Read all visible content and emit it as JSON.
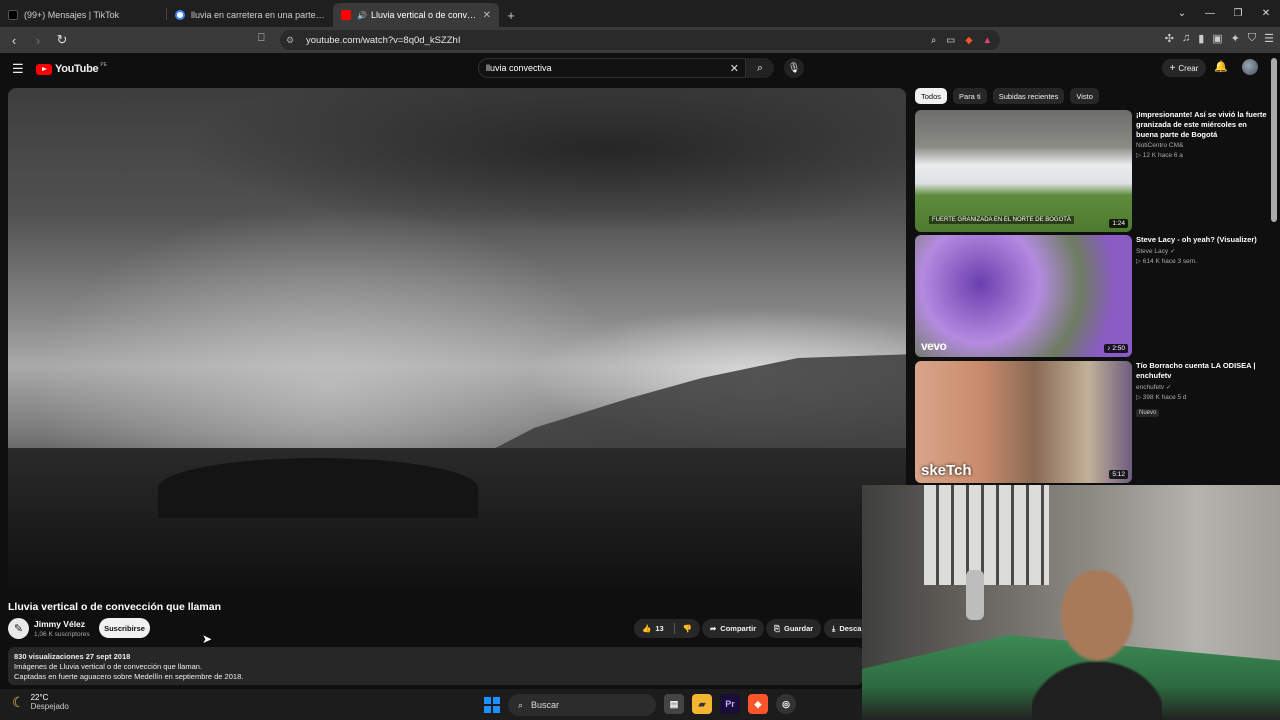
{
  "browser": {
    "tabs": [
      {
        "title": "(99+) Mensajes | TikTok",
        "favicon_color": "#000000"
      },
      {
        "title": "lluvia en carretera en una parte llueve",
        "favicon_color": "#4285f4"
      },
      {
        "title": "Lluvia vertical o de convección",
        "favicon_color": "#ff0000",
        "active": true
      }
    ],
    "url": "youtube.com/watch?v=8q0d_kSZZhI"
  },
  "youtube": {
    "logo_text": "YouTube",
    "country": "PE",
    "search_query": "lluvia convectiva",
    "create_label": "Crear"
  },
  "video": {
    "title": "Lluvia vertical o de convección que llaman",
    "channel": "Jimmy Vélez",
    "subscribers": "1,06 K suscriptores",
    "subscribe_label": "Suscribirse",
    "likes": "13",
    "share_label": "Compartir",
    "save_label": "Guardar",
    "download_label": "Desca",
    "views_date": "830 visualizaciones  27 sept 2018",
    "desc_line1": "Imágenes de Lluvia vertical o de convección que llaman.",
    "desc_line2": "Captadas en fuerte aguacero sobre Medellín en septiembre de 2018."
  },
  "sidebar": {
    "chips": [
      "Todos",
      "Para ti",
      "Subidas recientes",
      "Visto"
    ],
    "recs": [
      {
        "title": "¡Impresionante! Así se vivió la fuerte granizada de este miércoles en buena parte de Bogotá",
        "channel": "NotiCentro CM&",
        "meta": "▷ 12 K  hace 6 a",
        "duration": "1:24",
        "caption": "FUERTE GRANIZADA EN EL NORTE DE BOGOTÁ",
        "badge": ""
      },
      {
        "title": "Steve Lacy - oh yeah? (Visualizer)",
        "channel": "Steve Lacy ✓",
        "meta": "▷ 614 K  hace 3 sem.",
        "duration": "2:50",
        "overlay": "vevo",
        "badge": ""
      },
      {
        "title": "Tío Borracho cuenta LA ODISEA | enchufetv",
        "channel": "enchufetv ✓",
        "meta": "▷ 398 K  hace 5 d",
        "duration": "5:12",
        "overlay": "skeTch",
        "badge": "Nuevo"
      }
    ]
  },
  "taskbar": {
    "temp": "22°C",
    "condition": "Despejado",
    "search_label": "Buscar"
  }
}
